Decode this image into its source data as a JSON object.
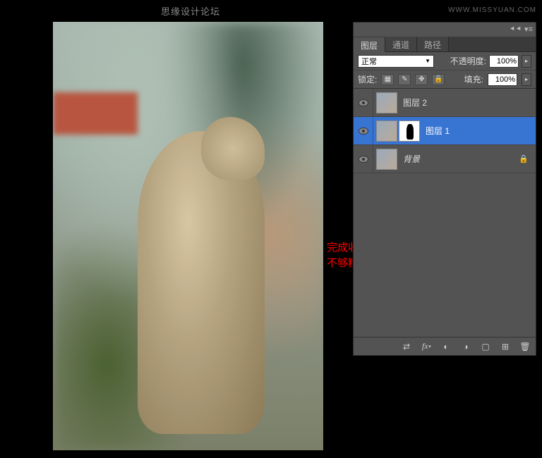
{
  "watermark": {
    "text": "思缘设计论坛",
    "url": "WWW.MISSYUAN.COM"
  },
  "red_overlay_text": "完成收工，喜欢的童鞋可以做一下，做的不够精细，不到处请大家多多包涵。",
  "panel": {
    "tabs": [
      "图层",
      "通道",
      "路径"
    ],
    "active_tab": 0,
    "blend_mode": "正常",
    "opacity_label": "不透明度:",
    "opacity_value": "100%",
    "lock_label": "锁定:",
    "fill_label": "填充:",
    "fill_value": "100%",
    "layers": [
      {
        "name": "图层 2",
        "visible": true,
        "selected": false,
        "has_mask": false,
        "locked": false
      },
      {
        "name": "图层 1",
        "visible": true,
        "selected": true,
        "has_mask": true,
        "locked": false
      },
      {
        "name": "背景",
        "visible": true,
        "selected": false,
        "has_mask": false,
        "locked": true
      }
    ],
    "footer_icons": [
      "link-icon",
      "fx-icon",
      "mask-icon",
      "adjustment-icon",
      "group-icon",
      "new-layer-icon",
      "trash-icon"
    ]
  }
}
